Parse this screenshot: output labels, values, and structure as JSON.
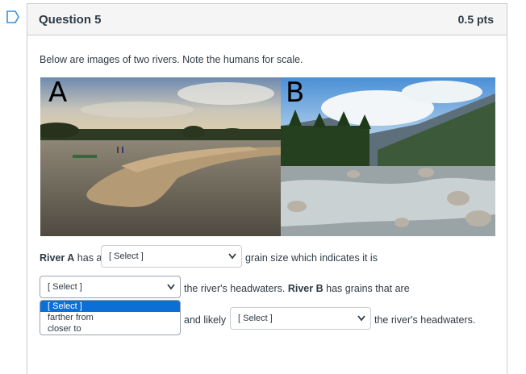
{
  "question": {
    "title": "Question 5",
    "points": "0.5 pts",
    "prompt": "Below are images of two rivers. Note the humans for scale."
  },
  "images": [
    {
      "label": "A"
    },
    {
      "label": "B"
    }
  ],
  "sentence": {
    "river_a": "River A",
    "has_a": "has a",
    "part1_after": "grain size which indicates it is",
    "part2_after": "the river's headwaters.",
    "river_b": "River B",
    "has_grains": "has grains that are",
    "and_likely": "and likely",
    "part3_after": "the river's headwaters."
  },
  "selects": {
    "grain_size": "[ Select ]",
    "distance_a": "[ Select ]",
    "distance_b": "[ Select ]"
  },
  "dropdown": {
    "options": [
      "[ Select ]",
      "farther from",
      "closer to"
    ],
    "selected_index": 0
  },
  "colors": {
    "selected_option": "#0b6fd6",
    "border": "#c7cdd1",
    "header_bg": "#f5f5f5"
  }
}
